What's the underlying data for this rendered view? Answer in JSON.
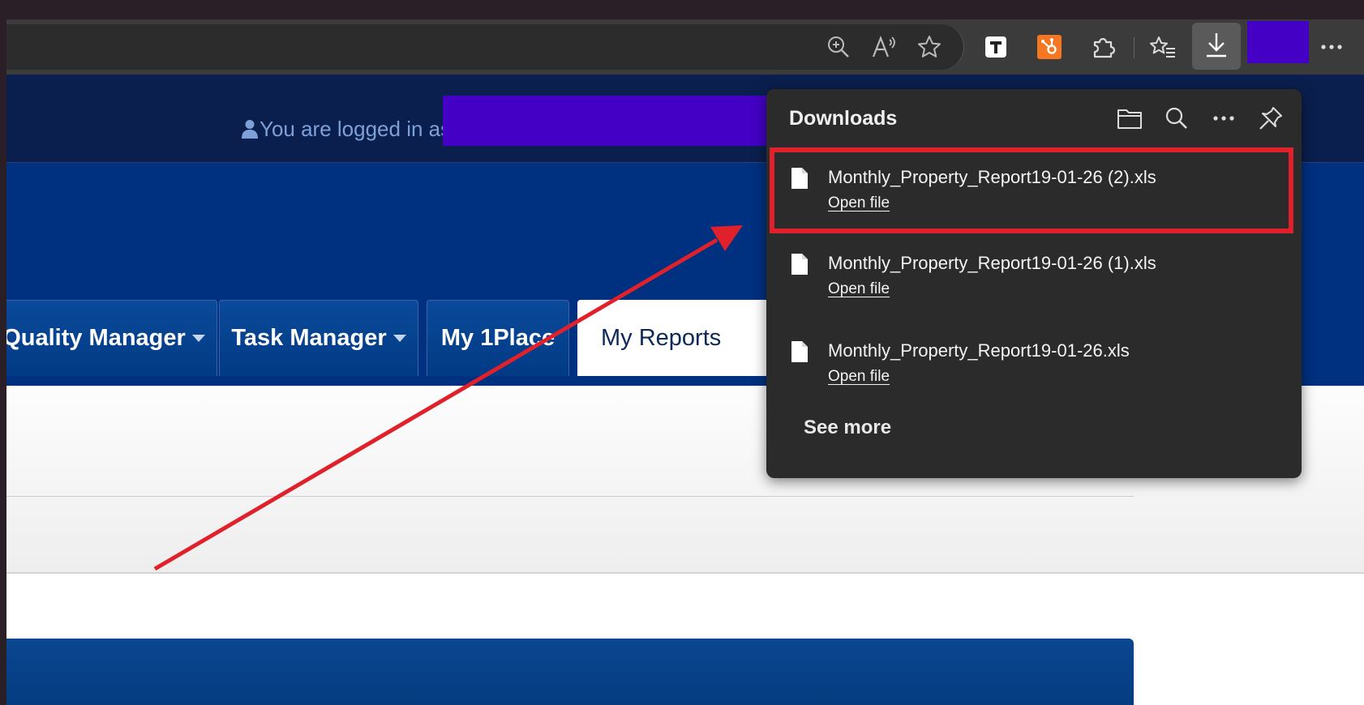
{
  "browser": {
    "toolbar_icons": [
      "zoom-in-icon",
      "read-aloud-icon",
      "favorite-star-icon",
      "t-extension-icon",
      "hubspot-extension-icon",
      "extensions-puzzle-icon",
      "favorites-list-icon",
      "downloads-icon",
      "more-options-icon"
    ],
    "hubspot_color": "#f57722",
    "redaction_color": "#4400c4"
  },
  "site": {
    "logged_in_text": "You are logged in as",
    "nav_tabs": [
      {
        "label": "Quality Manager",
        "has_dropdown": true
      },
      {
        "label": "Task Manager",
        "has_dropdown": true
      },
      {
        "label": "My 1Place",
        "has_dropdown": false
      },
      {
        "label": "My Reports",
        "has_dropdown": false,
        "active": true
      }
    ],
    "header_color": "#0b1f4e",
    "banner_color": "#003080"
  },
  "downloads": {
    "title": "Downloads",
    "items": [
      {
        "file_name": "Monthly_Property_Report19-01-26 (2).xls",
        "action": "Open file",
        "highlighted": true
      },
      {
        "file_name": "Monthly_Property_Report19-01-26 (1).xls",
        "action": "Open file",
        "highlighted": false
      },
      {
        "file_name": "Monthly_Property_Report19-01-26.xls",
        "action": "Open file",
        "highlighted": false
      }
    ],
    "see_more": "See more",
    "highlight_color": "#e0202a"
  },
  "annotation": {
    "arrow_color": "#e0202a"
  }
}
